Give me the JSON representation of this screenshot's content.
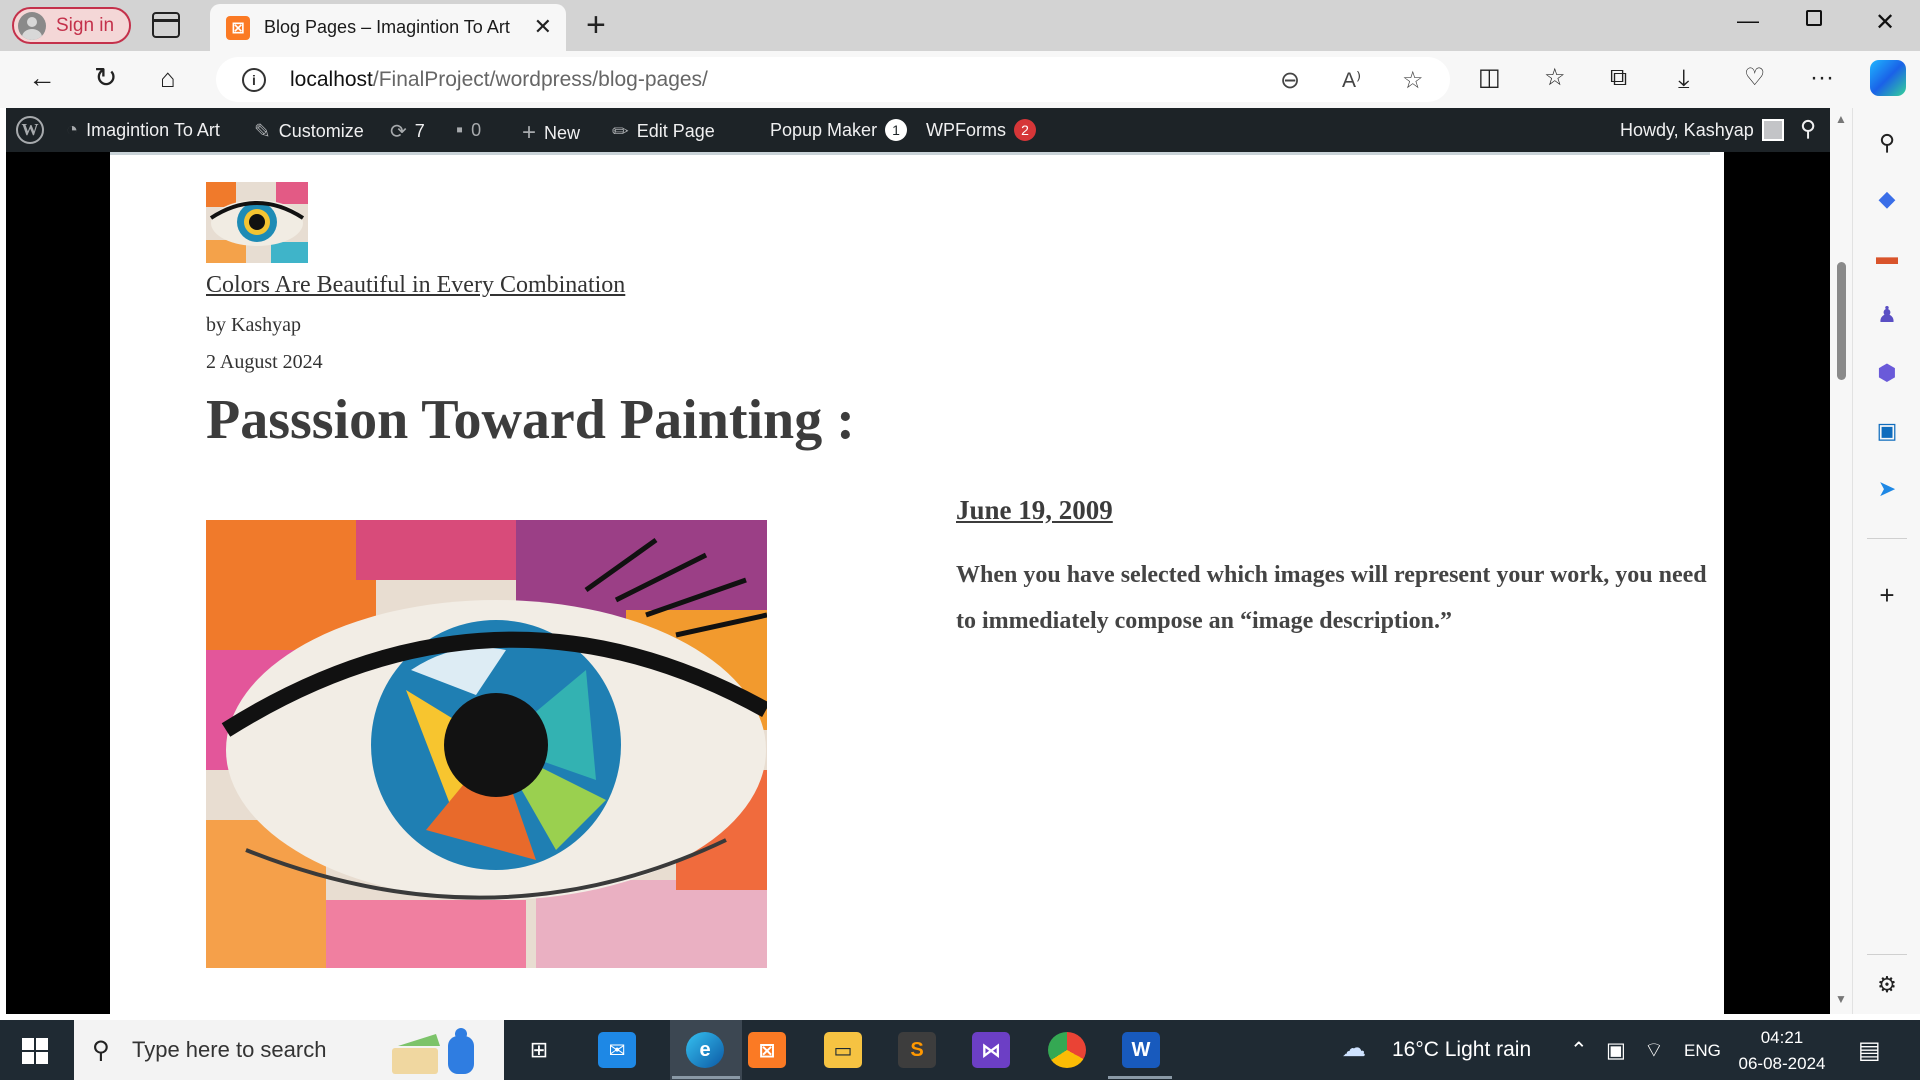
{
  "browser": {
    "sign_in": "Sign in",
    "tab_title": "Blog Pages – Imagintion To Art",
    "url_host": "localhost",
    "url_path": "/FinalProject/wordpress/blog-pages/"
  },
  "adminbar": {
    "site_name": "Imagintion To Art",
    "customize": "Customize",
    "updates_count": "7",
    "comments_count": "0",
    "new": "New",
    "edit_page": "Edit Page",
    "popup_maker": "Popup Maker",
    "popup_maker_badge": "1",
    "wpforms": "WPForms",
    "wpforms_badge": "2",
    "howdy": "Howdy, Kashyap"
  },
  "page": {
    "post_link": "Colors Are Beautiful in Every Combination",
    "post_author": "by Kashyap",
    "post_date": "2 August 2024",
    "title": "Passsion Toward Painting :",
    "side_date": "June 19, 2009",
    "side_text": "When you have selected which images will represent your work, you need to immediately compose an “image description.”"
  },
  "taskbar": {
    "search_placeholder": "Type here to search",
    "weather": "16°C  Light rain",
    "language": "ENG",
    "time": "04:21",
    "date": "06-08-2024"
  },
  "colors": {
    "adminbar_bg": "#1d2327",
    "signin_accent": "#c4314b",
    "badge_red": "#d63638",
    "taskbar_bg": "#1f2a33"
  }
}
